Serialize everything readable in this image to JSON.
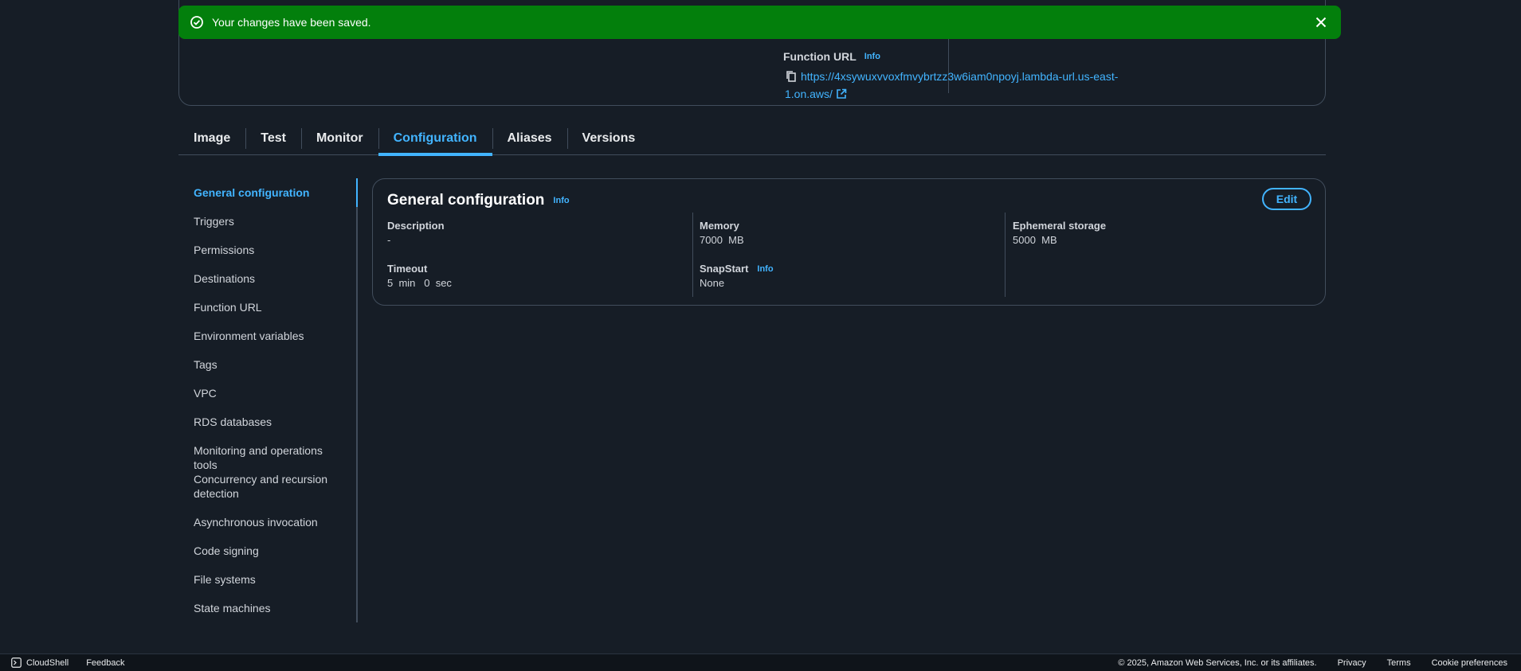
{
  "flash": {
    "message": "Your changes have been saved."
  },
  "function_url": {
    "label": "Function URL",
    "info": "Info",
    "url": "https://4xsywuxvvoxfmvybrtzz3w6iam0npoyj.lambda-url.us-east-1.on.aws/"
  },
  "tabs": [
    {
      "label": "Image"
    },
    {
      "label": "Test"
    },
    {
      "label": "Monitor"
    },
    {
      "label": "Configuration"
    },
    {
      "label": "Aliases"
    },
    {
      "label": "Versions"
    }
  ],
  "active_tab": "Configuration",
  "side_nav": {
    "items": [
      {
        "label": "General configuration"
      },
      {
        "label": "Triggers"
      },
      {
        "label": "Permissions"
      },
      {
        "label": "Destinations"
      },
      {
        "label": "Function URL"
      },
      {
        "label": "Environment variables"
      },
      {
        "label": "Tags"
      },
      {
        "label": "VPC"
      },
      {
        "label": "RDS databases"
      },
      {
        "label": "Monitoring and operations tools"
      },
      {
        "label": "Concurrency and recursion detection"
      },
      {
        "label": "Asynchronous invocation"
      },
      {
        "label": "Code signing"
      },
      {
        "label": "File systems"
      },
      {
        "label": "State machines"
      }
    ]
  },
  "general_config": {
    "title": "General configuration",
    "info": "Info",
    "edit_label": "Edit",
    "description": {
      "label": "Description",
      "value": "-"
    },
    "timeout": {
      "label": "Timeout",
      "value": "5  min   0  sec"
    },
    "memory": {
      "label": "Memory",
      "value": "7000  MB"
    },
    "snapstart": {
      "label": "SnapStart",
      "info": "Info",
      "value": "None"
    },
    "ephemeral": {
      "label": "Ephemeral storage",
      "value": "5000  MB"
    }
  },
  "footer": {
    "cloudshell": "CloudShell",
    "feedback": "Feedback",
    "copyright": "© 2025, Amazon Web Services, Inc. or its affiliates.",
    "privacy": "Privacy",
    "terms": "Terms",
    "cookie": "Cookie preferences"
  },
  "colors": {
    "background": "#161d26",
    "accent": "#42b4ff",
    "success": "#037f0c",
    "border": "#414d5c"
  }
}
